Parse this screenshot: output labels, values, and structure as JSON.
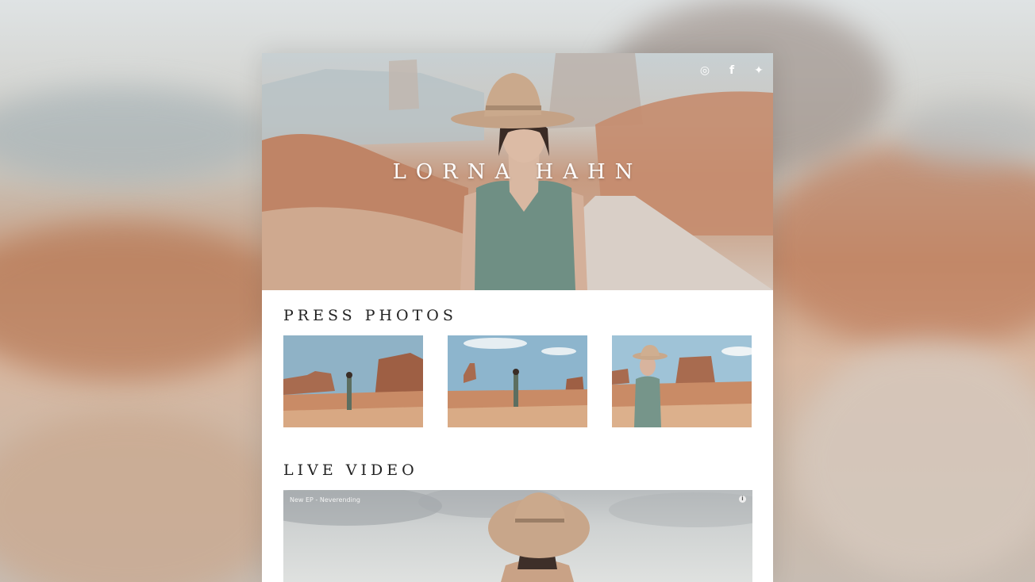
{
  "site": {
    "artist_name": "LORNA HAHN"
  },
  "social": {
    "icons": [
      "instagram-icon",
      "facebook-icon",
      "twitter-icon"
    ]
  },
  "sections": {
    "press_title": "PRESS PHOTOS",
    "video_title": "LIVE VIDEO"
  },
  "video": {
    "label": "New EP - Neverending"
  },
  "colors": {
    "card_bg": "#ffffff",
    "title_text": "#222222",
    "hero_text": "#ffffff"
  }
}
